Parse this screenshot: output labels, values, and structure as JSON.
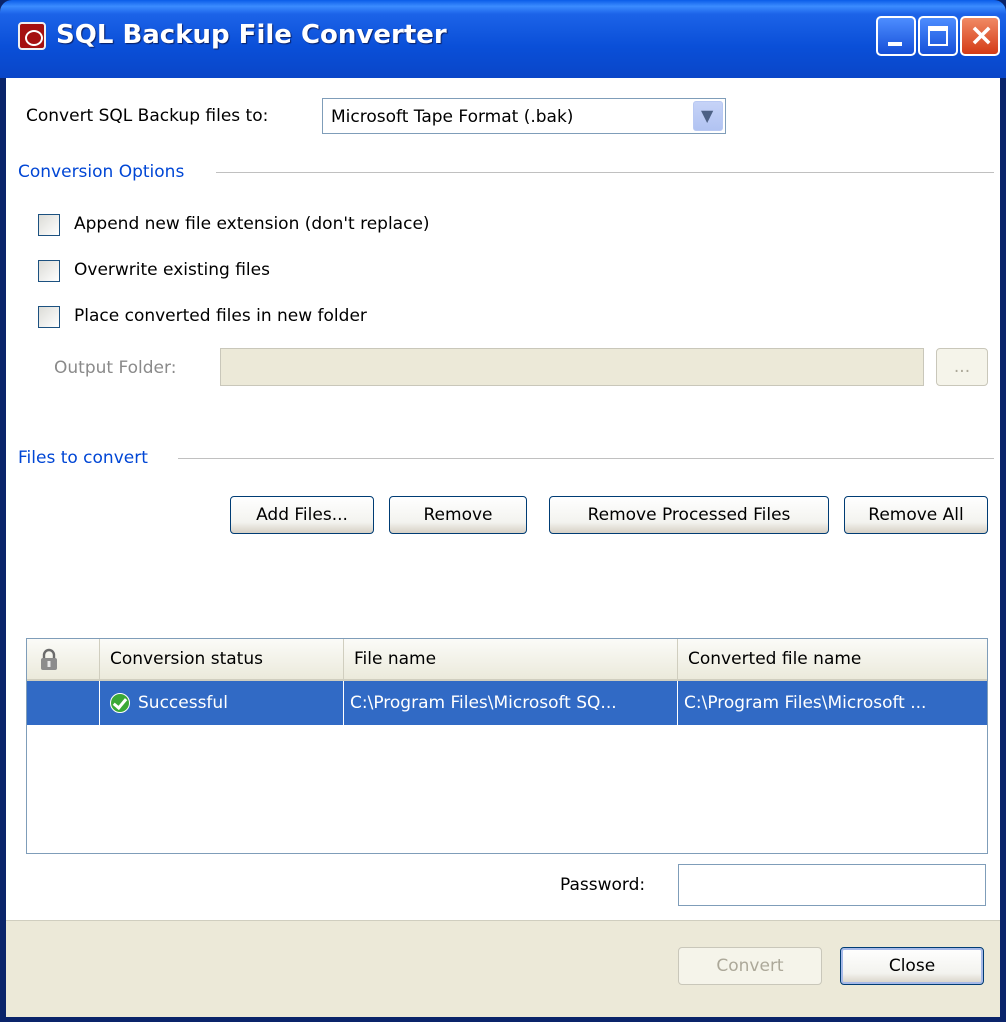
{
  "window": {
    "title": "SQL Backup File Converter"
  },
  "format": {
    "label": "Convert SQL Backup files to:",
    "selected": "Microsoft Tape Format (.bak)"
  },
  "options": {
    "section_title": "Conversion Options",
    "append_label": "Append new file extension (don't replace)",
    "overwrite_label": "Overwrite existing files",
    "place_label": "Place converted files in new folder",
    "output_folder_label": "Output Folder:",
    "browse_label": "..."
  },
  "files": {
    "section_title": "Files to convert",
    "add_button": "Add Files...",
    "remove_button": "Remove",
    "remove_processed_button": "Remove Processed Files",
    "remove_all_button": "Remove All",
    "columns": [
      "Conversion status",
      "File name",
      "Converted file name"
    ],
    "rows": [
      {
        "status": "Successful",
        "file_name": "C:\\Program Files\\Microsoft SQ...",
        "converted_name": "C:\\Program Files\\Microsoft ..."
      }
    ]
  },
  "password": {
    "label": "Password:",
    "value": ""
  },
  "footer": {
    "convert_button": "Convert",
    "close_button": "Close"
  },
  "icons": {
    "app": "sql-backup-app-icon",
    "lock": "lock-icon",
    "status": "success-check-icon",
    "dropdown": "chevron-down-icon"
  }
}
